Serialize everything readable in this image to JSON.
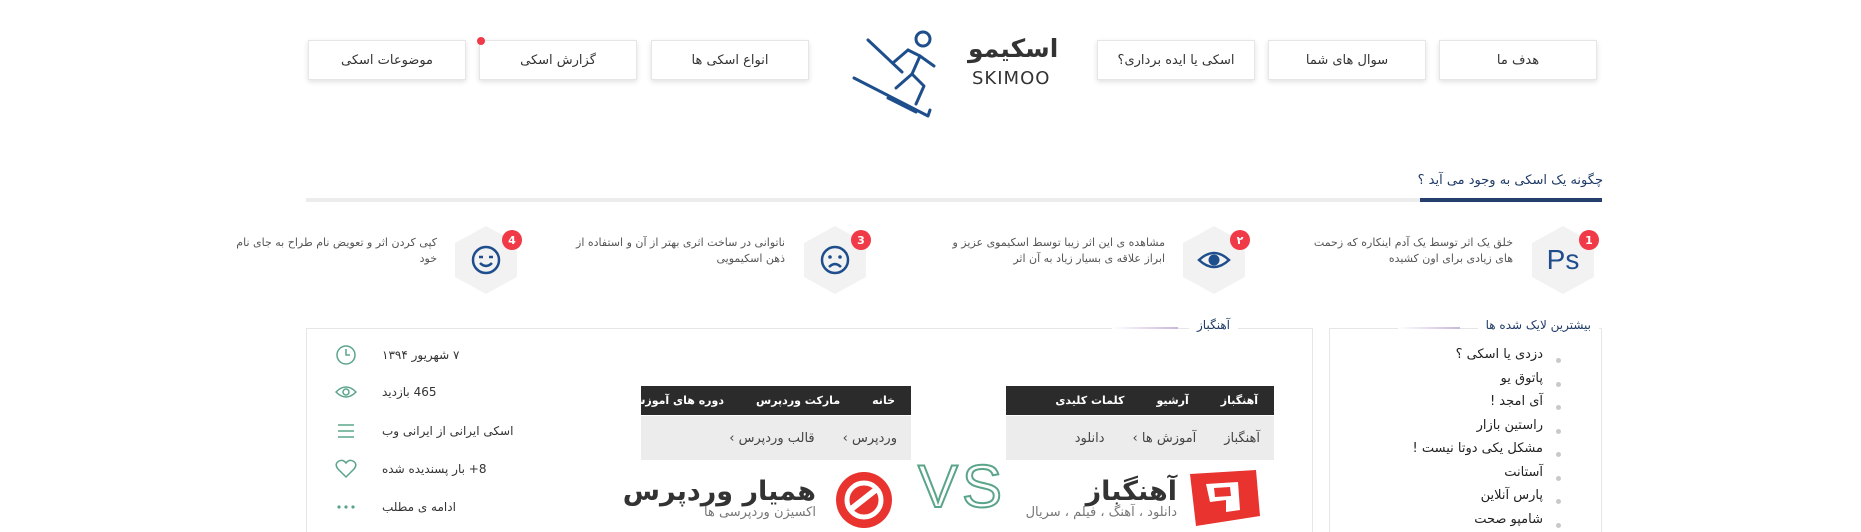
{
  "nav": {
    "right": [
      "هدف ما",
      "سوال های شما",
      "اسکی یا ایده برداری؟"
    ],
    "left": [
      "انواع اسکی ها",
      "گزارش اسکی",
      "موضوعات اسکی"
    ]
  },
  "logo": {
    "fa": "اسکیمو",
    "en": "SKIMOO"
  },
  "how": {
    "title": "چگونه یک اسکی به وجود می آید ؟",
    "steps": [
      {
        "num": "1",
        "icon": "photoshop-icon",
        "icon_text": "Ps",
        "text": "خلق یک اثر توسط یک آدم اینکاره که زحمت های زیادی برای اون کشیده"
      },
      {
        "num": "۲",
        "icon": "eye-icon",
        "text": "مشاهده ی این اثر زیبا توسط اسکیموی عزیز و ابراز علاقه ی بسیار زیاد به آن اثر"
      },
      {
        "num": "3",
        "icon": "sad-face-icon",
        "text": "ناتوانی در ساخت اثری بهتر از آن و استفاده از ذهن اسکیمویی"
      },
      {
        "num": "4",
        "icon": "smile-face-icon",
        "text": "کپی کردن اثر و تعویض نام طراح به جای نام خود"
      }
    ]
  },
  "most_liked": {
    "title": "بیشترین لایک شده ها",
    "items": [
      "دزدی یا اسکی ؟",
      "پاتوق یو",
      "آی امجد !",
      "راستین بازار",
      "مشکل یکی دوتا نیست !",
      "آستانت",
      "پارس آنلاین",
      "شامپو صحت"
    ]
  },
  "post": {
    "title": "آهنگباز",
    "meta": [
      {
        "icon": "clock-icon",
        "text": "۷ شهریور ۱۳۹۴"
      },
      {
        "icon": "eye-icon",
        "text": "465 بازدید"
      },
      {
        "icon": "menu-icon",
        "text": "اسکی ایرانی از ایرانی  وب"
      },
      {
        "icon": "heart-icon",
        "text": "8+ بار پسندیده شده"
      },
      {
        "icon": "more-icon",
        "text": "ادامه ی مطلب"
      }
    ],
    "right_site": {
      "menu": [
        "آهنگباز",
        "آرشیو",
        "کلمات کلیدی"
      ],
      "crumbs": [
        "آهنگباز",
        "آموزش ها  ›",
        "دانلود"
      ],
      "name": "آهنگباز",
      "sub": "دانلود ، آهنگ ، فیلم ، سریال"
    },
    "left_site": {
      "menu": [
        "خانه",
        "مارکت وردپرس",
        "دوره های آموزشی"
      ],
      "crumbs": [
        "وردپرس  ›",
        "قالب وردپرس  ›"
      ],
      "name": "همیار وردپرس",
      "sub": "اکسیژن وردپرسی ها"
    },
    "vs": "VS"
  },
  "colors": {
    "accent": "#f03a47",
    "navy": "#1f3b66",
    "green": "#5aa58a"
  }
}
